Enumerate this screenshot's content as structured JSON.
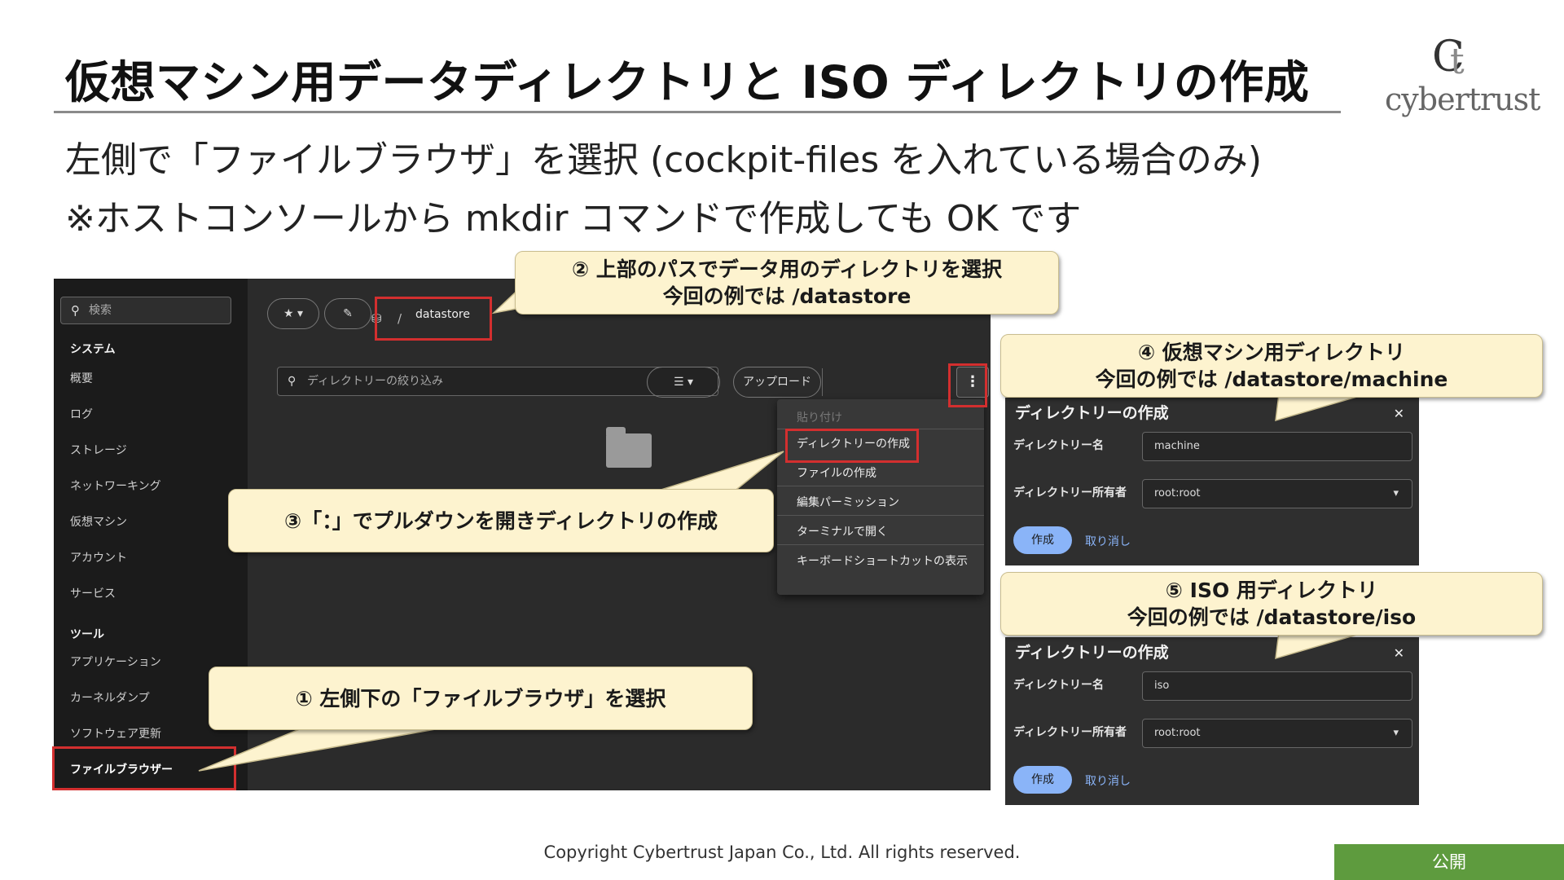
{
  "slide": {
    "title": "仮想マシン用データディレクトリと ISO ディレクトリの作成",
    "subtitle_line1": "左側で「ファイルブラウザ」を選択 (cockpit-files を入れている場合のみ)",
    "subtitle_line2": "※ホストコンソールから mkdir コマンドで作成しても OK です",
    "logo_text": "cybertrust",
    "copyright": "Copyright Cybertrust Japan Co., Ltd. All rights reserved.",
    "badge": "公開"
  },
  "sidebar": {
    "search_placeholder": "検索",
    "section_system": "システム",
    "system_items": [
      "概要",
      "ログ",
      "ストレージ",
      "ネットワーキング",
      "仮想マシン",
      "アカウント",
      "サービス"
    ],
    "section_tools": "ツール",
    "tool_items": [
      "アプリケーション",
      "カーネルダンプ",
      "ソフトウェア更新",
      "ファイルブラウザー"
    ]
  },
  "files": {
    "breadcrumb_sep": "/",
    "breadcrumb_dir": "datastore",
    "filter_placeholder": "ディレクトリーの絞り込み",
    "upload_label": "アップロード",
    "kebab_label": "⋮",
    "menu": [
      "貼り付け",
      "ディレクトリーの作成",
      "ファイルの作成",
      "編集パーミッション",
      "ターミナルで開く",
      "キーボードショートカットの表示"
    ]
  },
  "dialog_machine": {
    "title": "ディレクトリーの作成",
    "name_label": "ディレクトリー名",
    "name_value": "machine",
    "owner_label": "ディレクトリー所有者",
    "owner_value": "root:root",
    "create_label": "作成",
    "cancel_label": "取り消し"
  },
  "dialog_iso": {
    "title": "ディレクトリーの作成",
    "name_label": "ディレクトリー名",
    "name_value": "iso",
    "owner_label": "ディレクトリー所有者",
    "owner_value": "root:root",
    "create_label": "作成",
    "cancel_label": "取り消し"
  },
  "callouts": {
    "c1": "① 左側下の「ファイルブラウザ」を選択",
    "c2_line1": "② 上部のパスでデータ用のディレクトリを選択",
    "c2_line2": "今回の例では /datastore",
    "c3": "③「：」でプルダウンを開きディレクトリの作成",
    "c4_line1": "④ 仮想マシン用ディレクトリ",
    "c4_line2": "今回の例では /datastore/machine",
    "c5_line1": "⑤ ISO 用ディレクトリ",
    "c5_line2": "今回の例では /datastore/iso"
  },
  "colors": {
    "highlight": "#d32f2f",
    "callout_bg": "#fdf3cf",
    "badge_green": "#5e9b3e",
    "dark_bg": "#2b2b2b",
    "accent_blue": "#8ab4f8"
  }
}
